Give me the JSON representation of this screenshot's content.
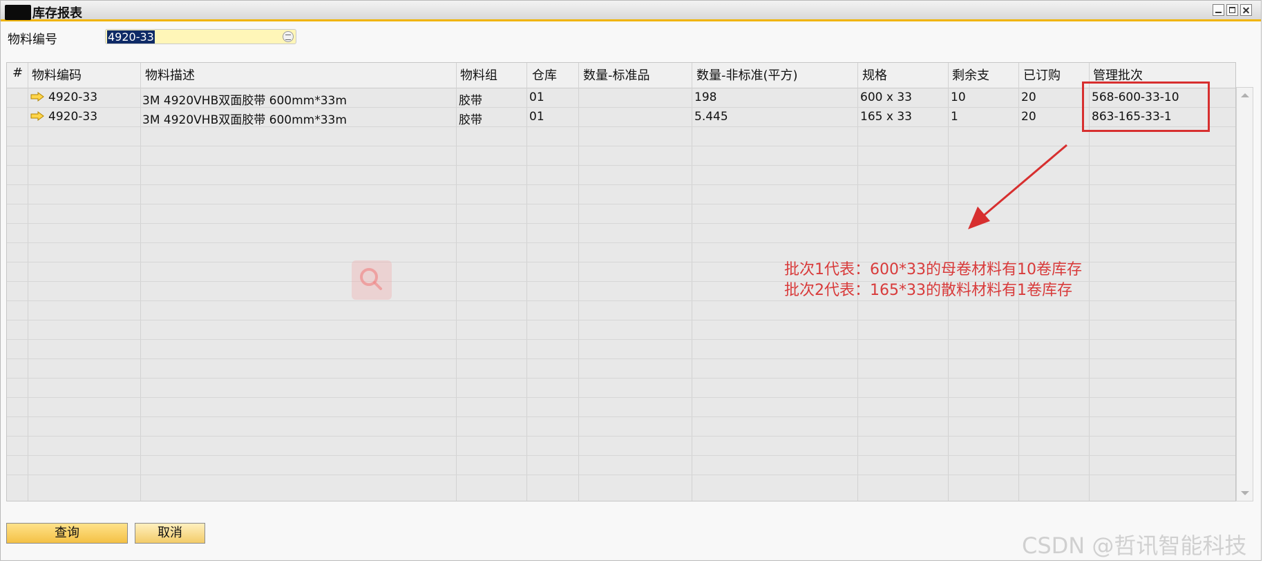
{
  "window": {
    "title": "库存报表"
  },
  "filter": {
    "label": "物料编号",
    "value": "4920-33"
  },
  "table": {
    "headers": [
      "#",
      "物料编码",
      "物料描述",
      "物料组",
      "仓库",
      "数量-标准品",
      "数量-非标准(平方)",
      "规格",
      "剩余支",
      "已订购",
      "管理批次"
    ],
    "rows": [
      {
        "code": "4920-33",
        "description": "3M 4920VHB双面胶带 600mm*33m",
        "group": "胶带",
        "warehouse": "01",
        "qty_standard": "",
        "qty_nonstandard": "198",
        "spec": "600 x 33",
        "remaining": "10",
        "ordered": "20",
        "batch": "568-600-33-10"
      },
      {
        "code": "4920-33",
        "description": "3M 4920VHB双面胶带 600mm*33m",
        "group": "胶带",
        "warehouse": "01",
        "qty_standard": "",
        "qty_nonstandard": "5.445",
        "spec": "165 x 33",
        "remaining": "1",
        "ordered": "20",
        "batch": "863-165-33-1"
      }
    ]
  },
  "annotations": [
    "批次1代表：600*33的母卷材料有10卷库存",
    "批次2代表：165*33的散料材料有1卷库存"
  ],
  "buttons": {
    "query": "查询",
    "cancel": "取消"
  },
  "credit": "CSDN @哲讯智能科技",
  "colors": {
    "accent": "#f0b400",
    "annotation_red": "#d72f2f",
    "input_bg": "#fff6b8",
    "selection": "#0e2a66"
  },
  "icons": [
    "row-arrow-icon",
    "list-icon",
    "search-icon",
    "minimize-icon",
    "maximize-icon",
    "close-icon"
  ]
}
